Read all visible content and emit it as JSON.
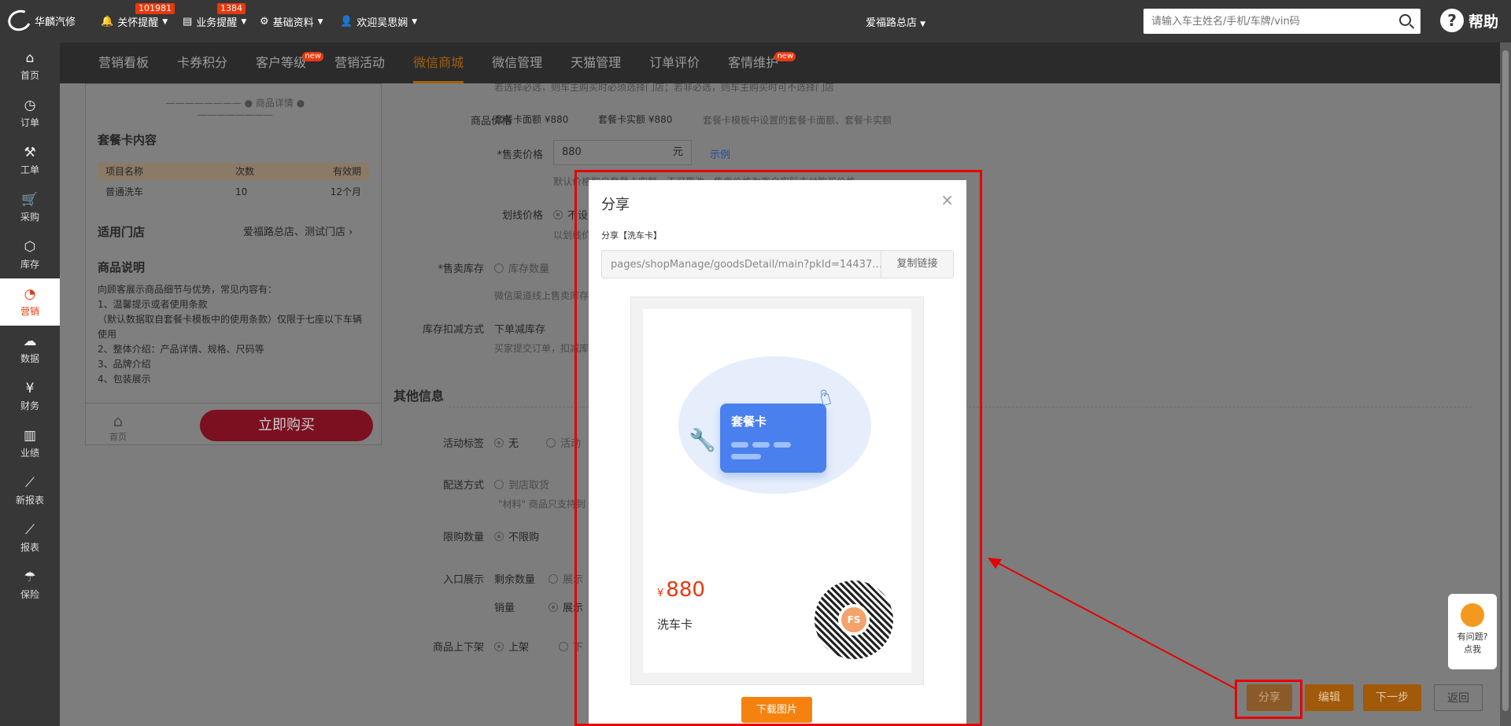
{
  "topbar": {
    "logo": "华麟汽修",
    "care": "关怀提醒",
    "care_badge": "101981",
    "biz": "业务提醒",
    "biz_badge": "1384",
    "basic": "基础资料",
    "welcome": "欢迎吴思娴",
    "store": "爱福路总店",
    "search_placeholder": "请输入车主姓名/手机/车牌/vin码",
    "help": "帮助"
  },
  "sidebar": [
    {
      "icon": "⌂",
      "label": "首页"
    },
    {
      "icon": "◷",
      "label": "订单"
    },
    {
      "icon": "⚒",
      "label": "工单"
    },
    {
      "icon": "🛒",
      "label": "采购"
    },
    {
      "icon": "⬡",
      "label": "库存"
    },
    {
      "icon": "◔",
      "label": "营销"
    },
    {
      "icon": "☁",
      "label": "数据"
    },
    {
      "icon": "¥",
      "label": "财务"
    },
    {
      "icon": "▥",
      "label": "业绩"
    },
    {
      "icon": "⟋",
      "label": "新报表"
    },
    {
      "icon": "⟋",
      "label": "报表"
    },
    {
      "icon": "☂",
      "label": "保险"
    }
  ],
  "subnav": {
    "t1": "营销看板",
    "t2": "卡券积分",
    "t3": "客户等级",
    "t4": "营销活动",
    "t5": "微信商城",
    "t6": "微信管理",
    "t7": "天猫管理",
    "t8": "订单评价",
    "t9": "客情维护",
    "new": "new"
  },
  "preview": {
    "sep": "商品详情",
    "pkg_title": "套餐卡内容",
    "h1": "项目名称",
    "h2": "次数",
    "h3": "有效期",
    "r1": "普通洗车",
    "r2": "10",
    "r3": "12个月",
    "store_title": "适用门店",
    "stores": "爱福路总店、测试门店",
    "desc_title": "商品说明",
    "desc": "向顾客展示商品细节与优势，常见内容有：\n1、温馨提示或者使用条款\n（默认数据取自套餐卡模板中的使用条款）仅限于七座以下车辆使用\n2、整体介绍：产品详情、规格、尺码等\n3、品牌介绍\n4、包装展示",
    "home": "首页",
    "buy": "立即购买"
  },
  "form": {
    "top_hint": "若选择必选，则车主购买时必须选择门店；若非必选，则车主购买时可不选择门店",
    "price_label": "商品价格",
    "face": "套餐卡面额 ¥880",
    "real": "套餐卡实额 ¥880",
    "price_hint": "套餐卡模板中设置的套餐卡面额、套餐卡实额",
    "sell_label": "*售卖价格",
    "sell_value": "880",
    "unit": "元",
    "example": "示例",
    "sell_hint": "默认价格取自套餐卡实额，不可更改，售卖价格为客户实际支付购买价格",
    "line_label": "划线价格",
    "line_opt": "不设",
    "line_hint": "以划线价",
    "stock_label": "*售卖库存",
    "stock_opt": "库存数量",
    "stock_hint": "微信渠道线上售卖库存",
    "deduct_label": "库存扣减方式",
    "deduct_val": "下单减库存",
    "deduct_hint": "买家提交订单，扣减库存",
    "other_title": "其他信息",
    "tag_label": "活动标签",
    "tag_opt1": "无",
    "tag_opt2": "活动",
    "ship_label": "配送方式",
    "ship_opt": "到店取货",
    "ship_hint": "\"材料\" 商品只支持到",
    "limit_label": "限购数量",
    "limit_opt": "不限购",
    "entry_label": "入口展示",
    "entry_a": "剩余数量",
    "entry_b": "销量",
    "show": "展示",
    "onoff_label": "商品上下架",
    "on": "上架",
    "off": "下"
  },
  "buttons": {
    "share": "分享",
    "edit": "编辑",
    "next": "下一步",
    "back": "返回"
  },
  "chat": {
    "line1": "有问题?",
    "line2": "点我"
  },
  "modal": {
    "title": "分享",
    "close": "×",
    "sub": "分享【洗车卡】",
    "link": "pages/shopManage/goodsDetail/main?pkId=14437…",
    "copy": "复制链接",
    "card_text": "套餐卡",
    "currency": "¥",
    "price": "880",
    "name": "洗车卡",
    "download": "下载图片"
  }
}
